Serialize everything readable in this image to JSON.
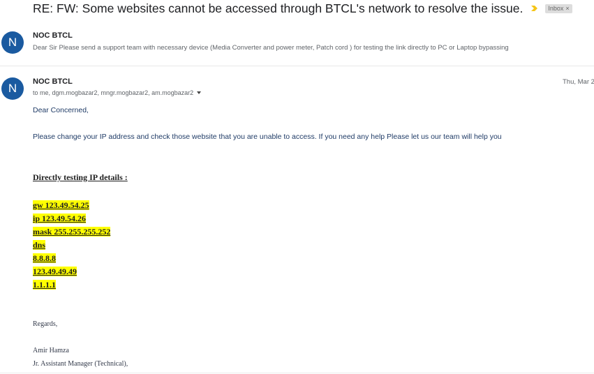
{
  "thread": {
    "subject": "RE: FW: Some websites cannot be accessed through BTCL's network to resolve the issue.",
    "important_icon": "importance-arrow-icon",
    "label_chip": "Inbox",
    "label_remove": "×"
  },
  "message_collapsed": {
    "avatar_letter": "N",
    "sender": "NOC BTCL",
    "snippet": "Dear Sir Please send a support team with necessary device (Media Converter and power meter, Patch cord ) for testing the link directly to PC or Laptop bypassing"
  },
  "message_expanded": {
    "avatar_letter": "N",
    "sender": "NOC BTCL",
    "recipients": "to me, dgm.mogbazar2, mngr.mogbazar2, am.mogbazar2",
    "date": "Thu, Mar 2",
    "greeting": "Dear Concerned,",
    "paragraph": "Please change your IP address and check those website that you are unable to access. If you need any help Please let us our team will help you",
    "ip_heading": "Directly testing IP details :",
    "ip_lines": [
      "gw 123.49.54.25",
      "ip 123.49.54.26",
      "mask 255.255.255.252",
      "dns",
      "8.8.8.8",
      "123.49.49.49",
      "1.1.1.1"
    ],
    "closing": "Regards,",
    "signature_name": "Amir Hamza",
    "signature_title": "Jr. Assistant Manager (Technical),"
  },
  "colors": {
    "avatar_bg": "#1a5aa0",
    "highlight": "#ffff00",
    "body_text": "#1f3b66",
    "importance": "#f5c518"
  }
}
